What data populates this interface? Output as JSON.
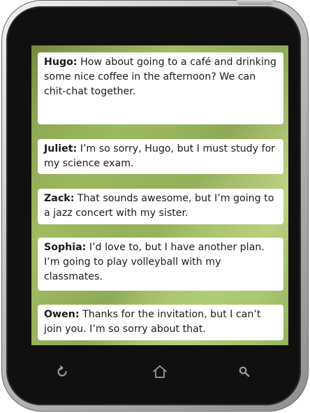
{
  "messages": [
    {
      "name": "Hugo:",
      "text": " How about going to a café and drinking some nice coffee in the afternoon? We can chit-chat together."
    },
    {
      "name": "Juliet:",
      "text": " I’m so sorry, Hugo, but I must study for my science exam."
    },
    {
      "name": "Zack:",
      "text": " That sounds awesome, but I’m going to a jazz concert with my sister."
    },
    {
      "name": "Sophia:",
      "text": " I’d love to, but I have another plan. I’m going to play volleyball with my classmates."
    },
    {
      "name": "Owen:",
      "text": " Thanks for the invitation, but I can’t join you. I’m so sorry about that."
    }
  ],
  "nav": {
    "back_icon": "refresh-icon",
    "home_icon": "home-icon",
    "search_icon": "search-icon"
  },
  "colors": {
    "bezel": "#101010",
    "screen_green": "#a4bd63",
    "bubble": "#ffffff",
    "icon_gray": "#9a9a9a"
  }
}
